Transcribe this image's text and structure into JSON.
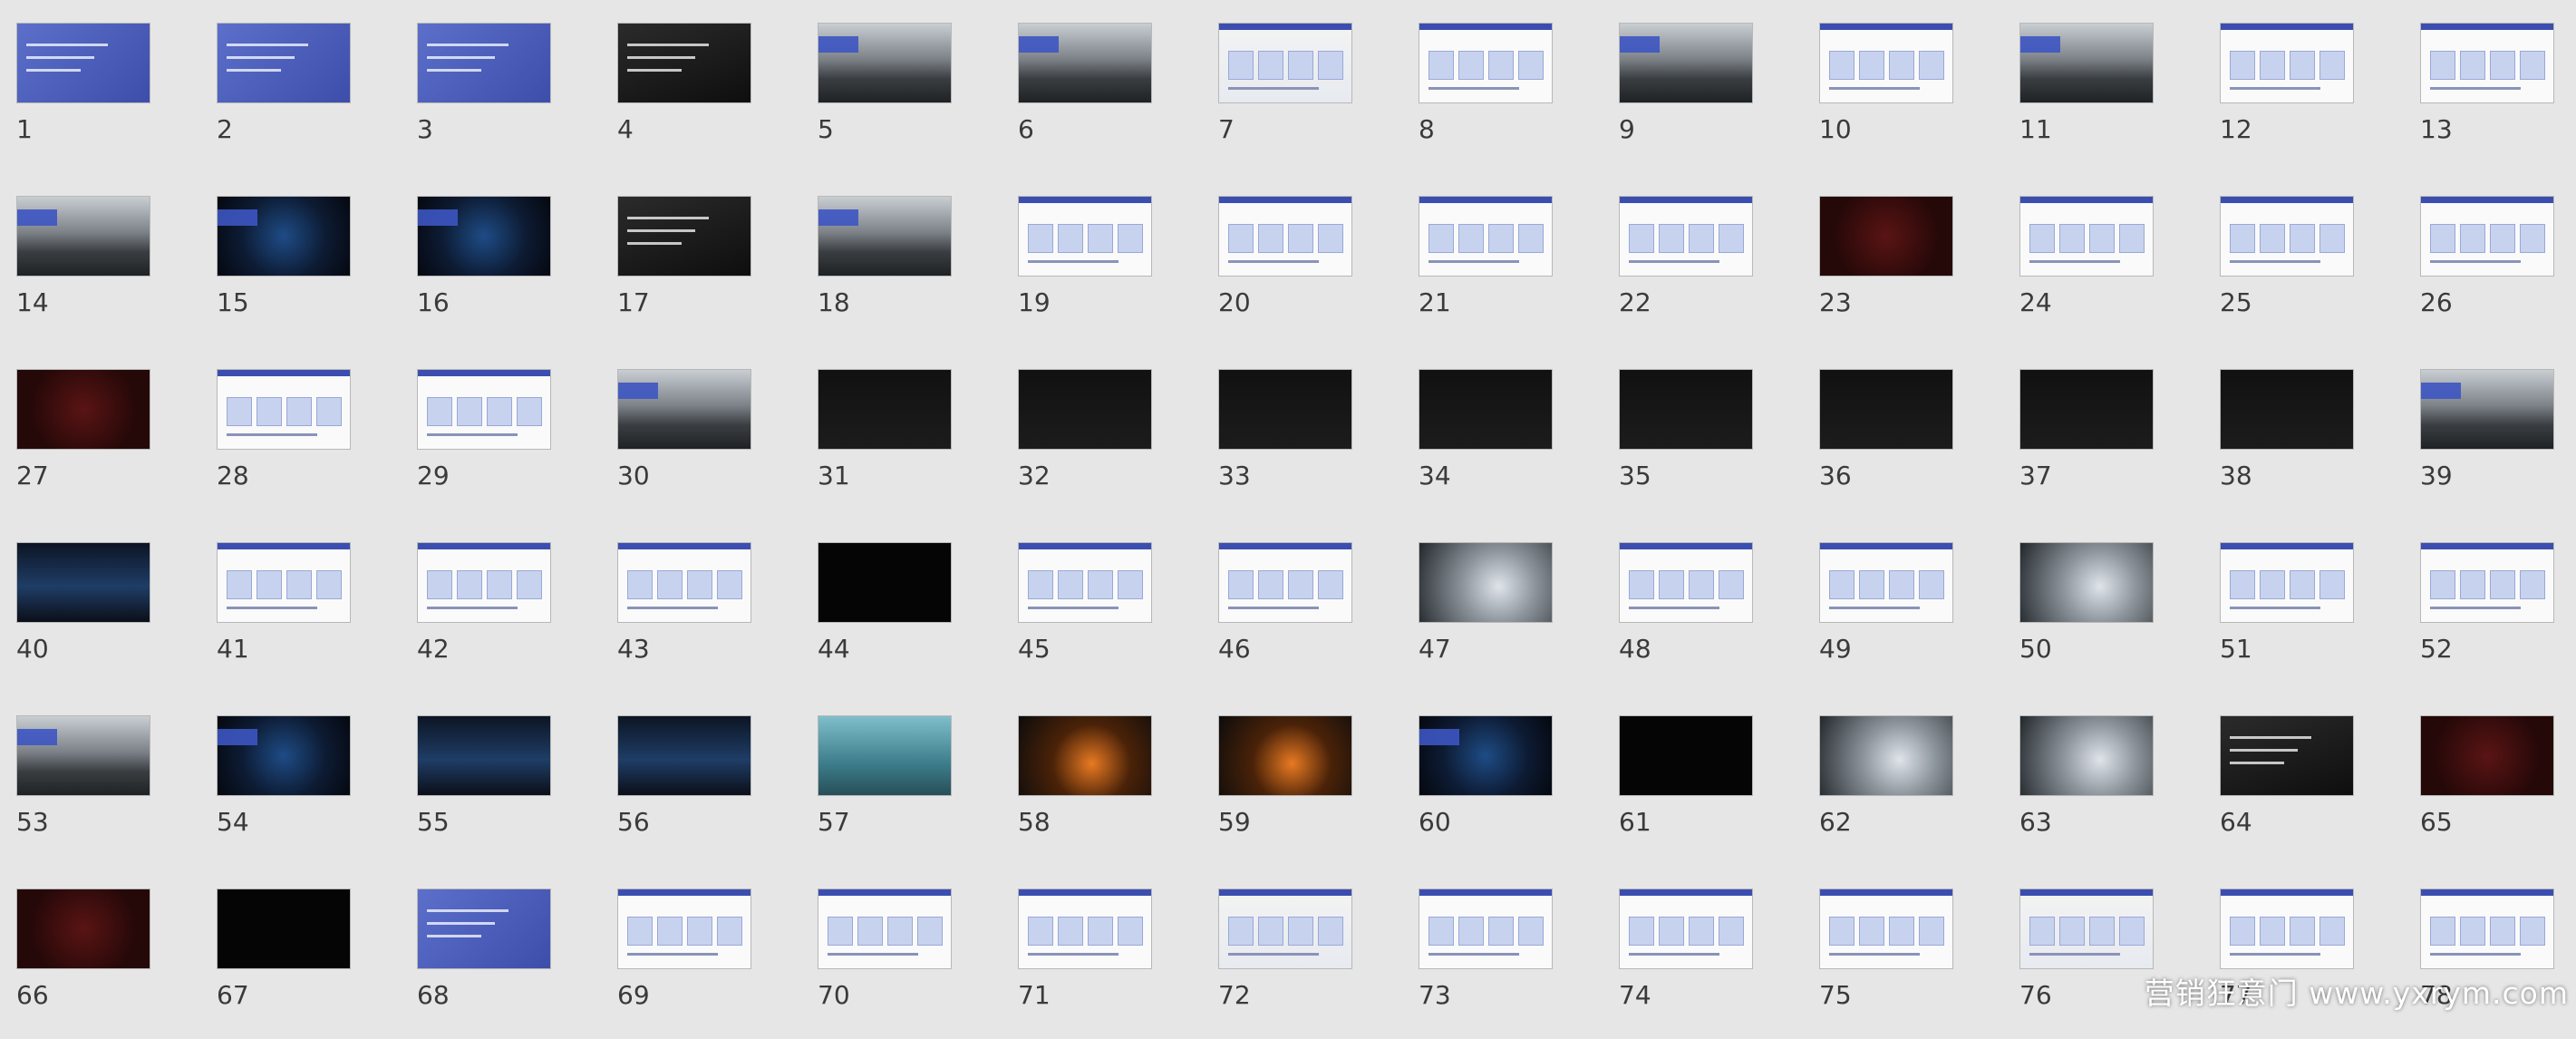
{
  "slides": [
    {
      "num": "1",
      "type": "blue"
    },
    {
      "num": "2",
      "type": "blue"
    },
    {
      "num": "3",
      "type": "blue"
    },
    {
      "num": "4",
      "type": "dark"
    },
    {
      "num": "5",
      "type": "city"
    },
    {
      "num": "6",
      "type": "city"
    },
    {
      "num": "7",
      "type": "map"
    },
    {
      "num": "8",
      "type": "white"
    },
    {
      "num": "9",
      "type": "city"
    },
    {
      "num": "10",
      "type": "white"
    },
    {
      "num": "11",
      "type": "city"
    },
    {
      "num": "12",
      "type": "white"
    },
    {
      "num": "13",
      "type": "white"
    },
    {
      "num": "14",
      "type": "city"
    },
    {
      "num": "15",
      "type": "stage"
    },
    {
      "num": "16",
      "type": "stage"
    },
    {
      "num": "17",
      "type": "dark"
    },
    {
      "num": "18",
      "type": "city"
    },
    {
      "num": "19",
      "type": "white"
    },
    {
      "num": "20",
      "type": "white"
    },
    {
      "num": "21",
      "type": "white"
    },
    {
      "num": "22",
      "type": "white"
    },
    {
      "num": "23",
      "type": "red"
    },
    {
      "num": "24",
      "type": "white"
    },
    {
      "num": "25",
      "type": "white"
    },
    {
      "num": "26",
      "type": "white"
    },
    {
      "num": "27",
      "type": "red"
    },
    {
      "num": "28",
      "type": "white"
    },
    {
      "num": "29",
      "type": "white"
    },
    {
      "num": "30",
      "type": "city"
    },
    {
      "num": "31",
      "type": "people"
    },
    {
      "num": "32",
      "type": "people"
    },
    {
      "num": "33",
      "type": "people"
    },
    {
      "num": "34",
      "type": "people"
    },
    {
      "num": "35",
      "type": "people"
    },
    {
      "num": "36",
      "type": "people"
    },
    {
      "num": "37",
      "type": "people"
    },
    {
      "num": "38",
      "type": "people"
    },
    {
      "num": "39",
      "type": "city"
    },
    {
      "num": "40",
      "type": "car"
    },
    {
      "num": "41",
      "type": "white"
    },
    {
      "num": "42",
      "type": "white"
    },
    {
      "num": "43",
      "type": "white"
    },
    {
      "num": "44",
      "type": "black"
    },
    {
      "num": "45",
      "type": "white"
    },
    {
      "num": "46",
      "type": "white"
    },
    {
      "num": "47",
      "type": "photo"
    },
    {
      "num": "48",
      "type": "white"
    },
    {
      "num": "49",
      "type": "white"
    },
    {
      "num": "50",
      "type": "photo"
    },
    {
      "num": "51",
      "type": "white"
    },
    {
      "num": "52",
      "type": "white"
    },
    {
      "num": "53",
      "type": "city"
    },
    {
      "num": "54",
      "type": "stage"
    },
    {
      "num": "55",
      "type": "car"
    },
    {
      "num": "56",
      "type": "car"
    },
    {
      "num": "57",
      "type": "teal"
    },
    {
      "num": "58",
      "type": "orange"
    },
    {
      "num": "59",
      "type": "orange"
    },
    {
      "num": "60",
      "type": "stage"
    },
    {
      "num": "61",
      "type": "black"
    },
    {
      "num": "62",
      "type": "photo"
    },
    {
      "num": "63",
      "type": "photo"
    },
    {
      "num": "64",
      "type": "dark"
    },
    {
      "num": "65",
      "type": "red"
    },
    {
      "num": "66",
      "type": "red"
    },
    {
      "num": "67",
      "type": "black"
    },
    {
      "num": "68",
      "type": "blue"
    },
    {
      "num": "69",
      "type": "white"
    },
    {
      "num": "70",
      "type": "white"
    },
    {
      "num": "71",
      "type": "white"
    },
    {
      "num": "72",
      "type": "map"
    },
    {
      "num": "73",
      "type": "white"
    },
    {
      "num": "74",
      "type": "white"
    },
    {
      "num": "75",
      "type": "white"
    },
    {
      "num": "76",
      "type": "map"
    },
    {
      "num": "77",
      "type": "white"
    },
    {
      "num": "78",
      "type": "white"
    }
  ],
  "watermark": "营销狂意门 www.yxrym.com"
}
